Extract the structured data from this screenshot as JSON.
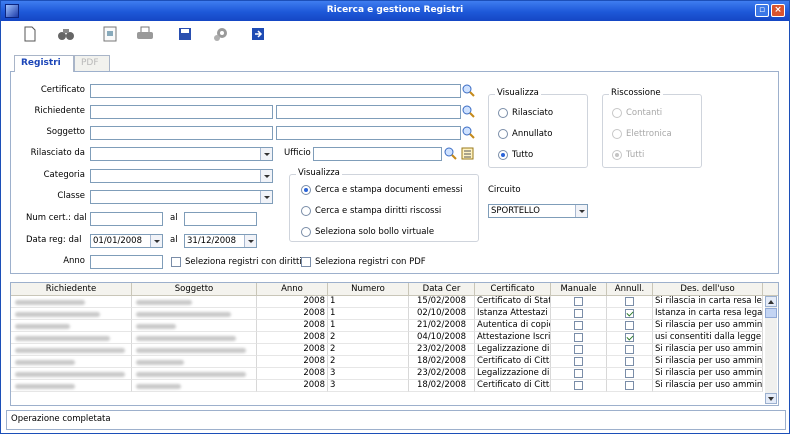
{
  "window": {
    "title": "Ricerca e gestione Registri"
  },
  "toolbar": {
    "icons": [
      "new-document-icon",
      "binoculars-icon",
      "preview-icon",
      "print-icon",
      "save-icon",
      "settings-icon",
      "exit-icon"
    ]
  },
  "tabs": [
    {
      "label": "Registri",
      "active": true
    },
    {
      "label": "PDF",
      "active": false,
      "disabled": true
    }
  ],
  "form": {
    "certificato_label": "Certificato",
    "richiedente_label": "Richiedente",
    "soggetto_label": "Soggetto",
    "rilasciato_da_label": "Rilasciato da",
    "ufficio_label": "Ufficio",
    "categoria_label": "Categoria",
    "classe_label": "Classe",
    "num_cert_dal_label": "Num cert.: dal",
    "num_cert_al_label": "al",
    "data_reg_dal_label": "Data reg: dal",
    "data_reg_dal_value": "01/01/2008",
    "data_reg_al_label": "al",
    "data_reg_al_value": "31/12/2008",
    "anno_label": "Anno",
    "chk_diritti_label": "Seleziona registri con diritti",
    "chk_pdf_label": "Seleziona registri con PDF"
  },
  "visualizza_inner": {
    "title": "Visualizza",
    "options": [
      "Cerca e stampa documenti emessi",
      "Cerca e stampa diritti riscossi",
      "Seleziona solo bollo virtuale"
    ],
    "selected": 0
  },
  "visualizza": {
    "title": "Visualizza",
    "options": [
      "Rilasciato",
      "Annullato",
      "Tutto"
    ],
    "selected": 2
  },
  "riscossione": {
    "title": "Riscossione",
    "options": [
      "Contanti",
      "Elettronica",
      "Tutti"
    ],
    "selected": 2
  },
  "circuito": {
    "label": "Circuito",
    "value": "SPORTELLO"
  },
  "grid": {
    "columns": [
      "Richiedente",
      "Soggetto",
      "Anno",
      "Numero",
      "Data Cer",
      "Certificato",
      "Manuale",
      "Annull.",
      "Des. dell'uso"
    ],
    "rows": [
      {
        "anno": "2008",
        "numero": "1",
        "data": "15/02/2008",
        "certificato": "Certificato di Stat",
        "manuale": false,
        "annull": false,
        "uso": "Si rilascia in carta resa leg"
      },
      {
        "anno": "2008",
        "numero": "1",
        "data": "02/10/2008",
        "certificato": "Istanza Attestazi",
        "manuale": false,
        "annull": true,
        "uso": "Istanza in carta resa legal"
      },
      {
        "anno": "2008",
        "numero": "1",
        "data": "21/02/2008",
        "certificato": "Autentica di copie",
        "manuale": false,
        "annull": false,
        "uso": "Si rilascia per uso amminis"
      },
      {
        "anno": "2008",
        "numero": "2",
        "data": "04/10/2008",
        "certificato": "Attestazione Iscri",
        "manuale": false,
        "annull": true,
        "uso": "usi consentiti dalla legge"
      },
      {
        "anno": "2008",
        "numero": "2",
        "data": "23/02/2008",
        "certificato": "Legalizzazione di f",
        "manuale": false,
        "annull": false,
        "uso": "Si rilascia per uso amminis"
      },
      {
        "anno": "2008",
        "numero": "2",
        "data": "18/02/2008",
        "certificato": "Certificato di Citta",
        "manuale": false,
        "annull": false,
        "uso": "Si rilascia per uso amminis"
      },
      {
        "anno": "2008",
        "numero": "3",
        "data": "23/02/2008",
        "certificato": "Legalizzazione di f",
        "manuale": false,
        "annull": false,
        "uso": "Si rilascia per uso amminis"
      },
      {
        "anno": "2008",
        "numero": "3",
        "data": "18/02/2008",
        "certificato": "Certificato di Citta",
        "manuale": false,
        "annull": false,
        "uso": "Si rilascia per uso amminis"
      }
    ]
  },
  "status": {
    "text": "Operazione completata"
  }
}
